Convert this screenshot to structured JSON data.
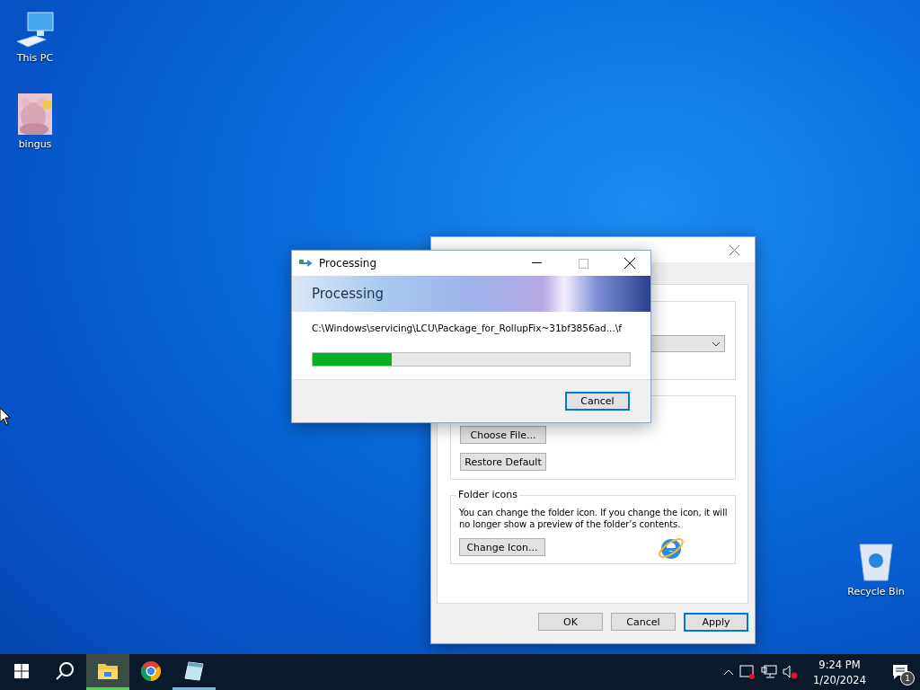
{
  "desktop_icons": [
    {
      "kind": "computer",
      "label": "This PC"
    },
    {
      "kind": "picture",
      "label": "bingus"
    },
    {
      "kind": "recycle",
      "label": "Recycle Bin"
    }
  ],
  "properties_window": {
    "folder_picture_buttons": [
      "Choose File...",
      "Restore Default"
    ],
    "folder_icons": {
      "title": "Folder icons",
      "text": "You can change the folder icon. If you change the icon, it will no longer show a preview of the folder’s contents.",
      "button": "Change Icon..."
    },
    "buttons": [
      {
        "label": "OK",
        "default": false
      },
      {
        "label": "Cancel",
        "default": false
      },
      {
        "label": "Apply",
        "default": true
      }
    ]
  },
  "processing_dialog": {
    "title": "Processing",
    "heading": "Processing",
    "path": "C:\\Windows\\servicing\\LCU\\Package_for_RollupFix~31bf3856ad...\\f",
    "progress": {
      "level": 0.25
    },
    "button": "Cancel"
  },
  "taskbar": {
    "apps": [
      {
        "kind": "explorer",
        "active": true,
        "running": true
      },
      {
        "kind": "chrome",
        "active": false,
        "running": false
      },
      {
        "kind": "notepad",
        "active": false,
        "running": true
      }
    ],
    "time": "9:24 PM",
    "date": "1/20/2024",
    "notifications": "1"
  }
}
